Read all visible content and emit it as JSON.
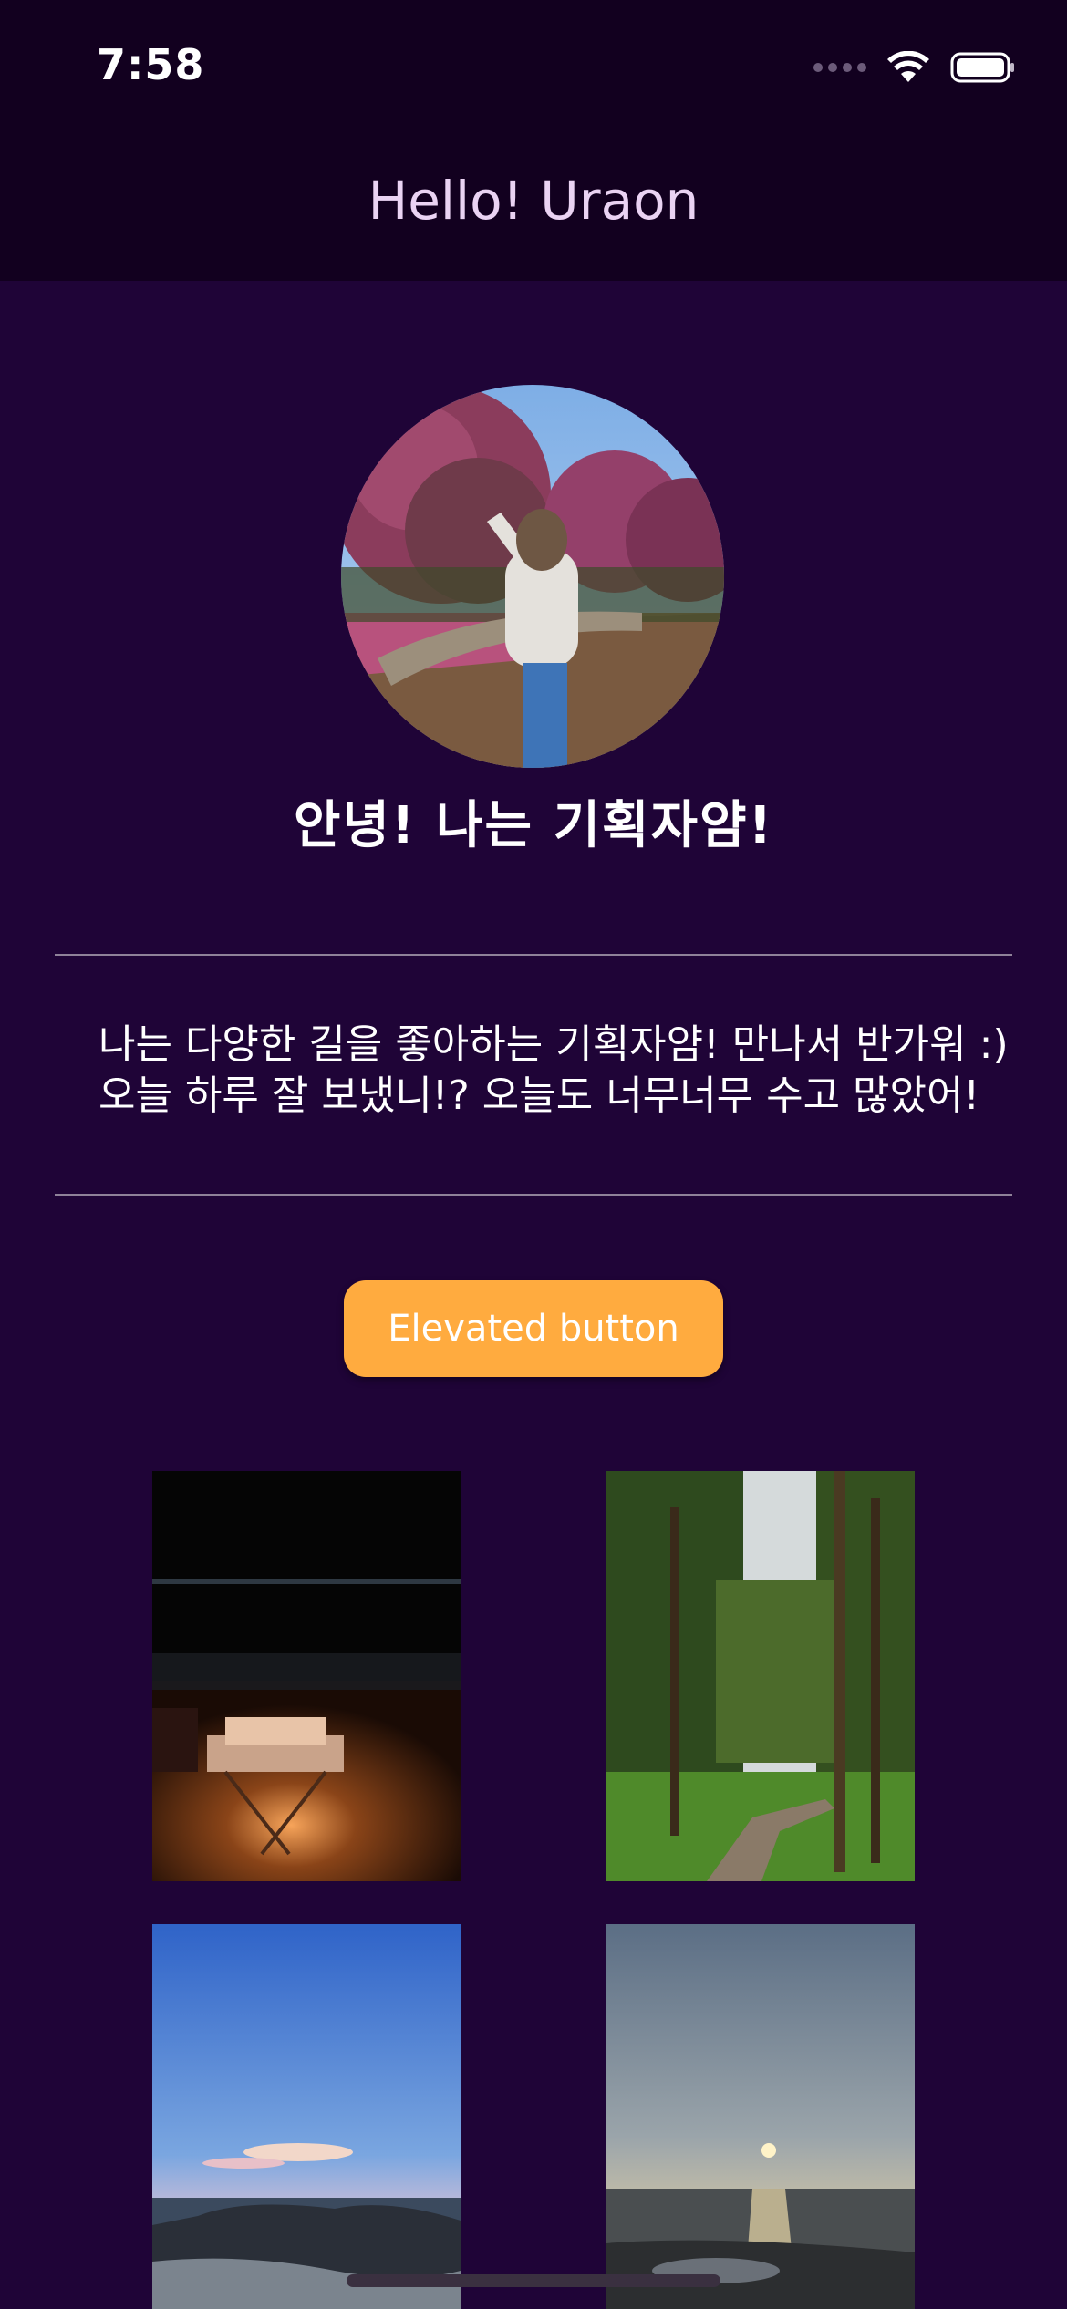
{
  "status_bar": {
    "time": "7:58",
    "icons": [
      "cellular-signal-icon",
      "wifi-icon",
      "battery-icon"
    ]
  },
  "app_bar": {
    "title": "Hello! Uraon"
  },
  "profile": {
    "avatar_icon": "profile-photo",
    "greeting": "안녕! 나는 기획자얌!"
  },
  "intro": {
    "line1": "나는 다양한 길을 좋아하는 기획자얌! 만나서 반가워 :)",
    "line2": "오늘 하루 잘 보냈니!? 오늘도 너무너무 수고 많았어!"
  },
  "button": {
    "label": "Elevated button"
  },
  "photos": [
    {
      "subject": "campfire-beach-night"
    },
    {
      "subject": "forest-boardwalk"
    },
    {
      "subject": "blue-sky-sea-rocks"
    },
    {
      "subject": "sunset-sea"
    }
  ],
  "colors": {
    "background": "#1f0437",
    "app_bar": "#12001f",
    "title_text": "#ead3f3",
    "button": "#ffab3f",
    "divider": "#8f8299"
  }
}
